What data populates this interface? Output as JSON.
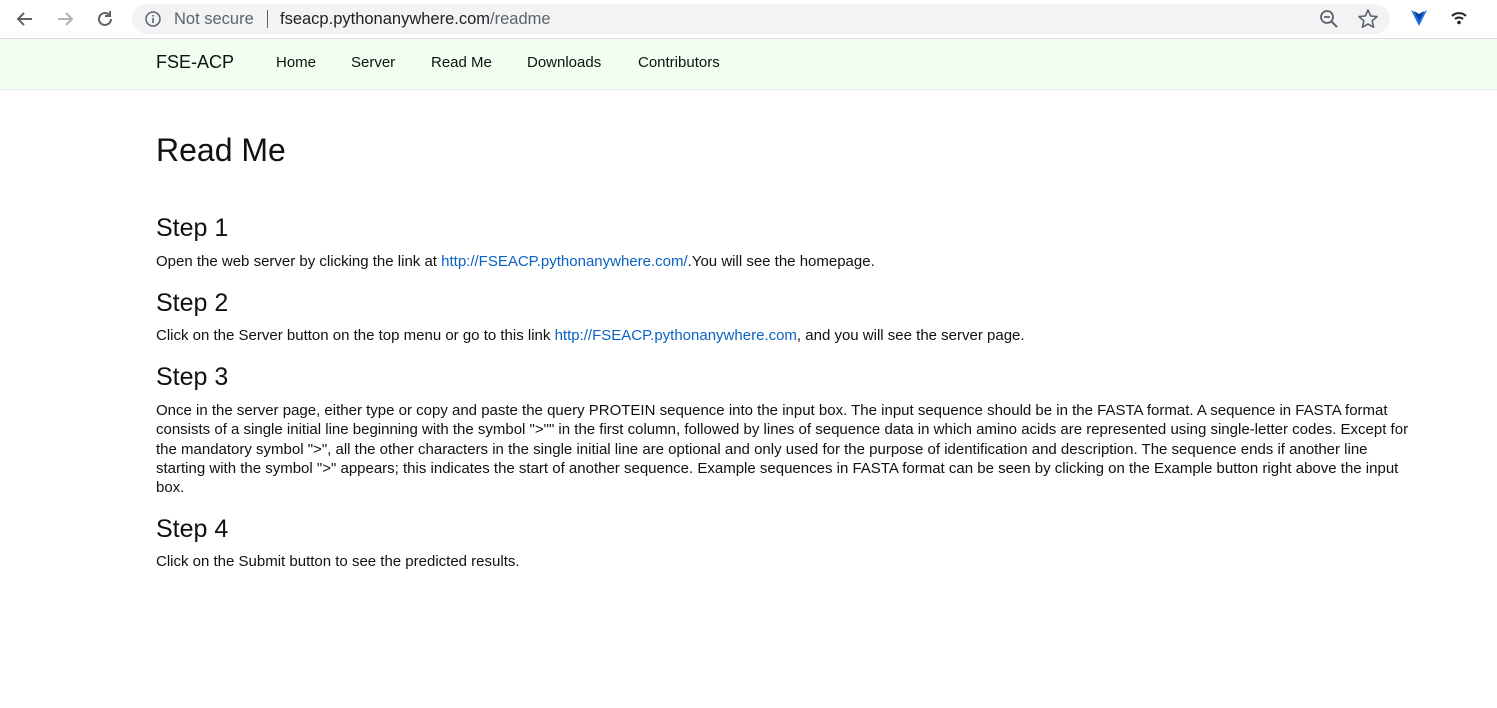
{
  "browser": {
    "security_label": "Not secure",
    "url_host": "fseacp.pythonanywhere.com",
    "url_path": "/readme"
  },
  "navbar": {
    "brand": "FSE-ACP",
    "links": [
      "Home",
      "Server",
      "Read Me",
      "Downloads",
      "Contributors"
    ]
  },
  "page": {
    "title": "Read Me",
    "steps": [
      {
        "title": "Step 1",
        "before": "Open the web server by clicking the link at ",
        "link": "http://FSEACP.pythonanywhere.com/",
        "after": ".You will see the homepage."
      },
      {
        "title": "Step 2",
        "before": "Click on the Server button on the top menu or go to this link ",
        "link": "http://FSEACP.pythonanywhere.com",
        "after": ", and you will see the server page."
      },
      {
        "title": "Step 3",
        "text": "Once in the server page, either type or copy and paste the query PROTEIN sequence into the input box. The input sequence should be in the FASTA format. A sequence in FASTA format consists of a single initial line beginning with the symbol \">\"\" in the first column, followed by lines of sequence data in which amino acids are represented using single-letter codes. Except for the mandatory symbol \">\", all the other characters in the single initial line are optional and only used for the purpose of identification and description. The sequence ends if another line starting with the symbol \">\" appears; this indicates the start of another sequence. Example sequences in FASTA format can be seen by clicking on the Example button right above the input box."
      },
      {
        "title": "Step 4",
        "text": "Click on the Submit button to see the predicted results."
      }
    ]
  },
  "colors": {
    "navbar_bg": "#f0fff0",
    "link": "#0b62c4"
  }
}
